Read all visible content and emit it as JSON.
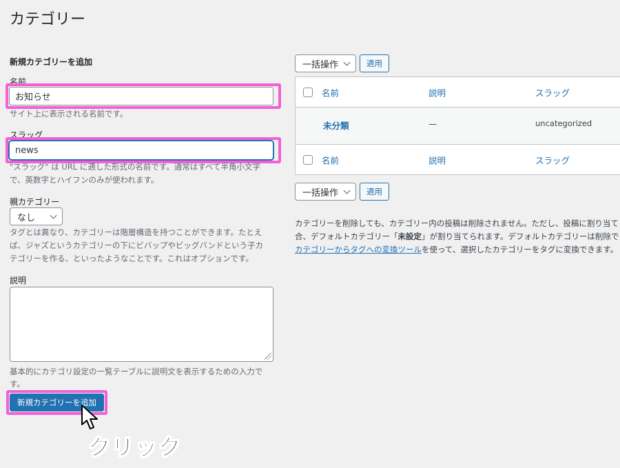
{
  "page_title": "カテゴリー",
  "form": {
    "title": "新規カテゴリーを追加",
    "name_label": "名前",
    "name_value": "お知らせ",
    "name_hint": "サイト上に表示される名前です。",
    "slug_label": "スラッグ",
    "slug_value": "news",
    "slug_hint_1": "\"スラッグ\" は URL に適した形式の名前です。通常はすべて半角小文字",
    "slug_hint_2": "で、英数字とハイフンのみが使われます。",
    "parent_label": "親カテゴリー",
    "parent_value": "なし",
    "parent_hint_1": "タグとは異なり、カテゴリーは階層構造を持つことができます。たとえ",
    "parent_hint_2": "ば、ジャズというカテゴリーの下にビバップやビッグバンドという子カ",
    "parent_hint_3": "テゴリーを作る、といったようなことです。これはオプションです。",
    "desc_label": "説明",
    "desc_hint_1": "基本的にカテゴリ設定の一覧テーブルに説明文を表示するための入力で",
    "desc_hint_2": "す。",
    "submit_label": "新規カテゴリーを追加"
  },
  "annotation": {
    "click_text": "クリック",
    "highlight_color": "#f45fd6"
  },
  "bulk": {
    "select_value": "一括操作",
    "apply_label": "適用"
  },
  "table": {
    "columns": {
      "name": "名前",
      "description": "説明",
      "slug": "スラッグ"
    },
    "rows": [
      {
        "name": "未分類",
        "description": "—",
        "slug": "uncategorized"
      }
    ]
  },
  "note": {
    "line1": "カテゴリーを削除しても、カテゴリー内の投稿は削除されません。ただし、投稿に割り当て",
    "line2_pre": "合、デフォルトカテゴリー「",
    "line2_strong": "未設定",
    "line2_post": "」が割り当てられます。デフォルトカテゴリーは削除で",
    "line3_link": "カテゴリーからタグへの変換ツール",
    "line3_post": "を使って、選択したカテゴリーをタグに変換できます。"
  },
  "colors": {
    "accent": "#2271b1",
    "background": "#f0f0f1"
  }
}
